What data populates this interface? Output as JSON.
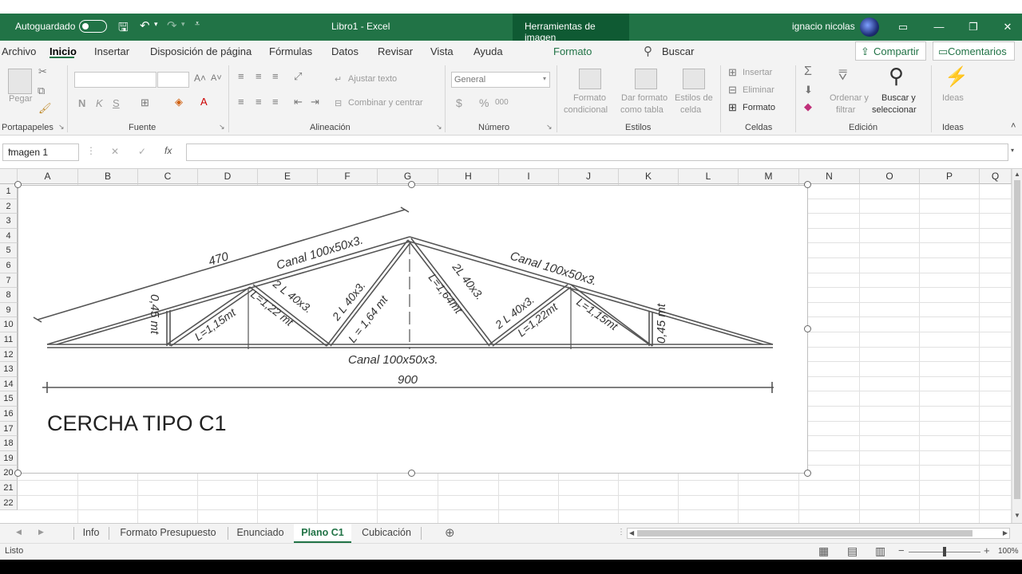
{
  "titlebar": {
    "autosave": "Autoguardado",
    "file": "Libro1  -  Excel",
    "context_tab": "Herramientas de imagen",
    "user": "ignacio nicolas"
  },
  "tabs": [
    "Archivo",
    "Inicio",
    "Insertar",
    "Disposición de página",
    "Fórmulas",
    "Datos",
    "Revisar",
    "Vista",
    "Ayuda",
    "Formato"
  ],
  "search_label": "Buscar",
  "share_label": "Compartir",
  "comments_label": "Comentarios",
  "ribbon": {
    "clipboard": {
      "paste": "Pegar",
      "group": "Portapapeles"
    },
    "font": {
      "group": "Fuente",
      "bold": "N",
      "italic": "K",
      "underline": "S"
    },
    "alignment": {
      "wrap": "Ajustar texto",
      "merge": "Combinar y centrar",
      "group": "Alineación"
    },
    "number": {
      "format": "General",
      "group": "Número",
      "currency": "$",
      "percent": "%",
      "thousands": "000"
    },
    "styles": {
      "cond": [
        "Formato",
        "condicional"
      ],
      "table": [
        "Dar formato",
        "como tabla"
      ],
      "cell": [
        "Estilos de",
        "celda"
      ],
      "group": "Estilos"
    },
    "cells": {
      "insert": "Insertar",
      "delete": "Eliminar",
      "format": "Formato",
      "group": "Celdas"
    },
    "editing": {
      "sort": [
        "Ordenar y",
        "filtrar"
      ],
      "find": [
        "Buscar y",
        "seleccionar"
      ],
      "group": "Edición"
    },
    "ideas": {
      "label": "Ideas",
      "group": "Ideas"
    }
  },
  "formula_bar": {
    "name_box": "Imagen 1",
    "cancel": "✕",
    "enter": "✓",
    "fx": "fx"
  },
  "columns": [
    "A",
    "B",
    "C",
    "D",
    "E",
    "F",
    "G",
    "H",
    "I",
    "J",
    "K",
    "L",
    "M",
    "N",
    "O",
    "P",
    "Q"
  ],
  "rows": [
    "1",
    "2",
    "3",
    "4",
    "5",
    "6",
    "7",
    "8",
    "9",
    "10",
    "11",
    "12",
    "13",
    "14",
    "15",
    "16",
    "17",
    "18",
    "19",
    "20",
    "21",
    "22"
  ],
  "drawing": {
    "top_left_length": "470",
    "left_chord": "Canal 100x50x3.",
    "right_chord": "Canal 100x50x3.",
    "bottom_chord": "Canal 100x50x3.",
    "span": "900",
    "title": "CERCHA TIPO C1",
    "left_post": "0,45 mt",
    "right_post": "0,45 mt",
    "d1": "L=1,15mt",
    "d2": "L=1,22 mt",
    "d3": "2 L 40x3.",
    "d4": "2 L 40x3.",
    "d5": "L = 1,64 mt",
    "d6": "2L 40x3.",
    "d7": "L=1,64mt",
    "d8": "2 L 40x3.",
    "d9": "L=1,22mt",
    "d10": "L=1,15mt"
  },
  "sheets": [
    "Info",
    "Formato Presupuesto",
    "Enunciado",
    "Plano C1",
    "Cubicación"
  ],
  "active_sheet": "Plano C1",
  "status": {
    "ready": "Listo",
    "zoom": "100%"
  }
}
